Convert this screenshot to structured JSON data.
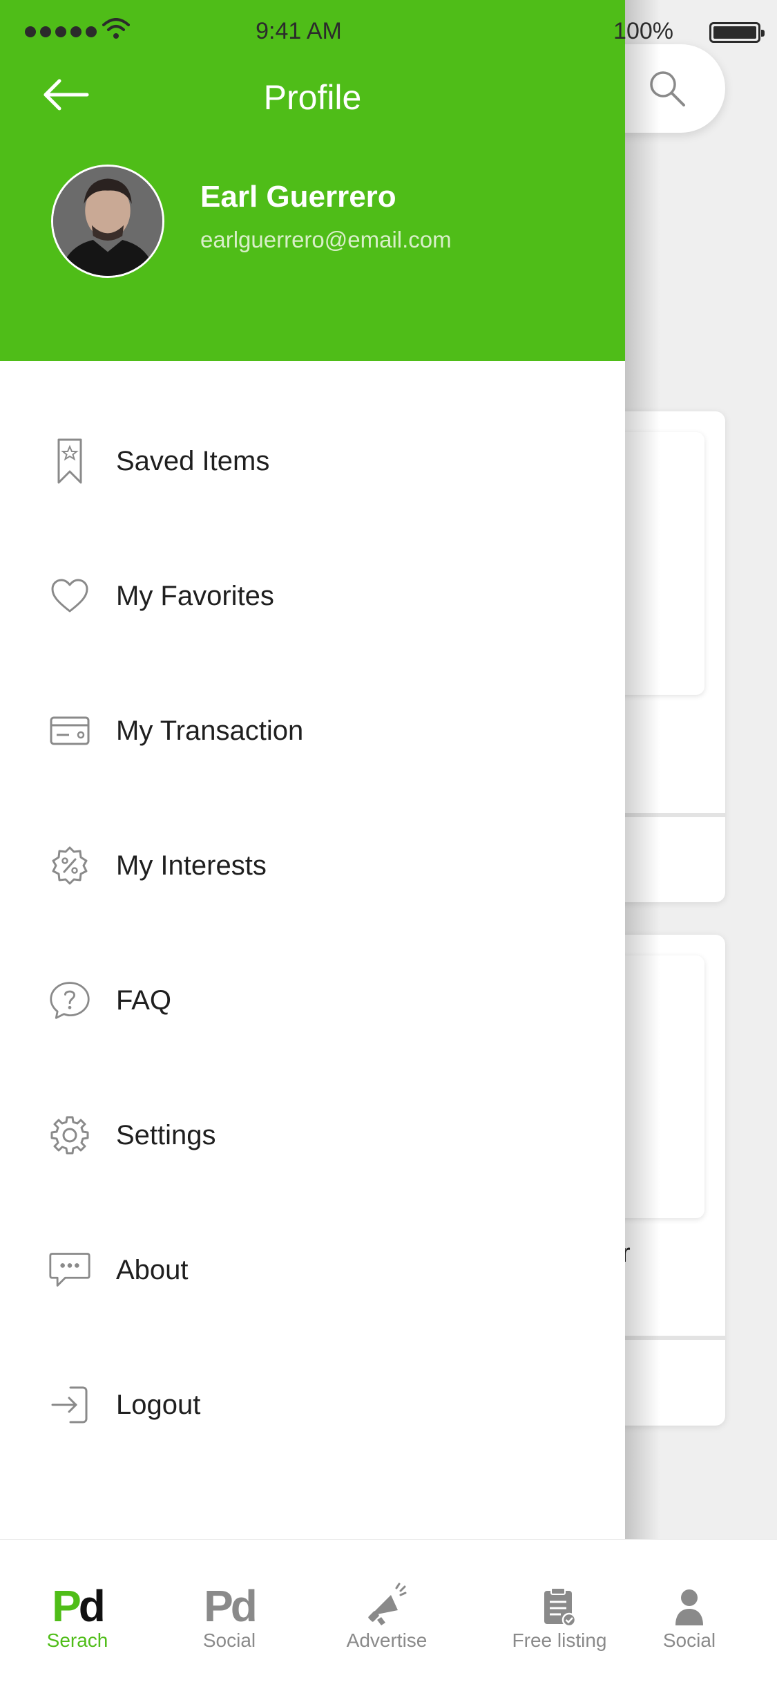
{
  "status_bar": {
    "time": "9:41 AM",
    "battery": "100%",
    "battery_level": 1.0
  },
  "drawer": {
    "title": "Profile",
    "user": {
      "name": "Earl Guerrero",
      "email": "earlguerrero@email.com"
    },
    "menu": [
      {
        "label": "Saved Items",
        "icon": "bookmark-star-icon"
      },
      {
        "label": "My Favorites",
        "icon": "heart-icon"
      },
      {
        "label": "My Transaction",
        "icon": "credit-card-icon"
      },
      {
        "label": "My Interests",
        "icon": "percent-badge-icon"
      },
      {
        "label": "FAQ",
        "icon": "question-bubble-icon"
      },
      {
        "label": "Settings",
        "icon": "gear-icon"
      },
      {
        "label": "About",
        "icon": "chat-dots-icon"
      },
      {
        "label": "Logout",
        "icon": "logout-icon"
      }
    ]
  },
  "background": {
    "partial_text": "r"
  },
  "tabbar": {
    "tabs": [
      {
        "label": "Serach",
        "icon": "pd-logo-icon",
        "active": true
      },
      {
        "label": "Social",
        "icon": "pd-logo-icon",
        "active": false
      },
      {
        "label": "Advertise",
        "icon": "megaphone-icon",
        "active": false
      },
      {
        "label": "Free listing",
        "icon": "clipboard-check-icon",
        "active": false
      },
      {
        "label": "Social",
        "icon": "person-icon",
        "active": false
      }
    ]
  },
  "colors": {
    "accent": "#4fbd18",
    "icon_gray": "#8a8a8a",
    "text": "#1f1f1f"
  }
}
